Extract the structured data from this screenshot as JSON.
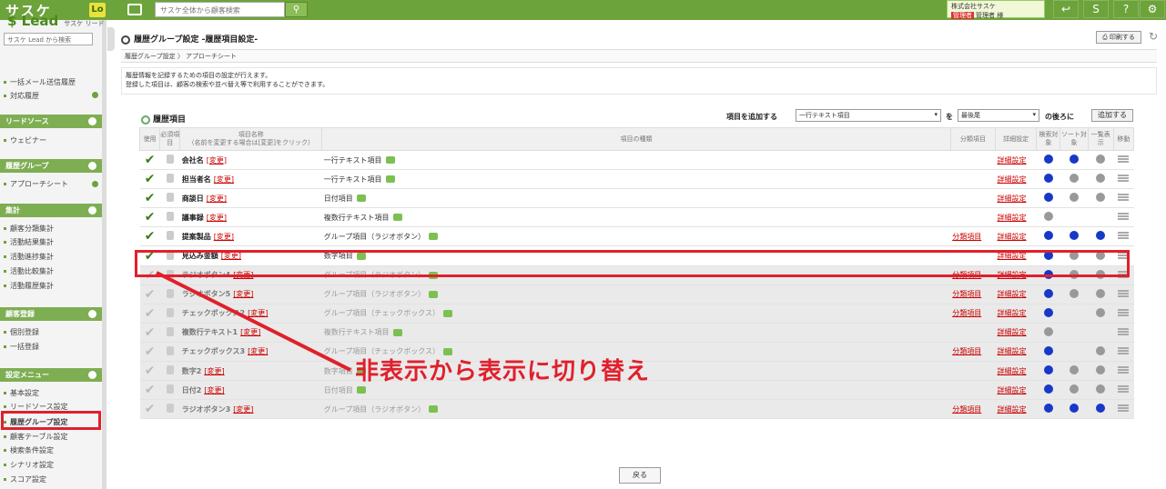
{
  "top": {
    "logo": "サスケ",
    "lo": "Lo",
    "search_placeholder": "サスケ全体から顧客検索",
    "user_company": "株式会社サスケ",
    "user_badge": "管理者",
    "user_name": "管理者 様",
    "help": "?"
  },
  "sidebar": {
    "logo": "Lead",
    "logo_sub": "サスケ リード",
    "search_placeholder": "サスケ Lead から検索",
    "links_top": [
      "一括メール送信履歴",
      "対応履歴"
    ],
    "sec_lead": "リードソース",
    "lead_items": [
      "ウェビナー"
    ],
    "sec_history": "履歴グループ",
    "history_items": [
      "アプローチシート"
    ],
    "sec_agg": "集計",
    "agg_items": [
      "顧客分類集計",
      "活動結果集計",
      "活動進捗集計",
      "活動比較集計",
      "活動履歴集計"
    ],
    "sec_reg": "顧客登録",
    "reg_items": [
      "個別登録",
      "一括登録"
    ],
    "sec_settings": "設定メニュー",
    "settings_items": [
      "基本設定",
      "リードソース設定",
      "履歴グループ設定",
      "顧客テーブル設定",
      "検索条件設定",
      "シナリオ設定",
      "スコア設定"
    ]
  },
  "page": {
    "title": "履歴グループ設定 -履歴項目設定-",
    "print": "印刷する",
    "crumb1": "履歴グループ設定",
    "crumb2": "アプローチシート",
    "desc1": "履歴情報を記録するための項目の設定が行えます。",
    "desc2": "登録した項目は、顧客の検索や並べ替え等で利用することができます。",
    "section": "履歴項目",
    "add_label": "項目を追加する",
    "add_type": "一行テキスト項目",
    "add_wo": "を",
    "add_pos": "最後尾",
    "add_after": "の後ろに",
    "add_button": "追加する",
    "back": "戻る"
  },
  "table": {
    "headers": {
      "use": "使用",
      "req": "必須項目",
      "name": "項目名称",
      "name_sub": "（名前を変更する場合は[変更]をクリック）",
      "type": "項目の種類",
      "cls": "分類項目",
      "detail": "詳細設定",
      "search": "検索対象",
      "sort": "ソート対象",
      "list": "一覧表示",
      "move": "移動"
    },
    "change_label": "[変更]",
    "cls_label": "分類項目",
    "detail_label": "詳細設定",
    "rows": [
      {
        "name": "会社名",
        "type": "一行テキスト項目",
        "cls": "",
        "hidden": false,
        "s": "blue",
        "o": "blue",
        "l": "gray"
      },
      {
        "name": "担当者名",
        "type": "一行テキスト項目",
        "cls": "",
        "hidden": false,
        "s": "blue",
        "o": "gray",
        "l": "gray"
      },
      {
        "name": "商談日",
        "type": "日付項目",
        "cls": "",
        "hidden": false,
        "s": "blue",
        "o": "gray",
        "l": "gray"
      },
      {
        "name": "議事録",
        "type": "複数行テキスト項目",
        "cls": "",
        "hidden": false,
        "s": "gray",
        "o": "none",
        "l": "none"
      },
      {
        "name": "提案製品",
        "type": "グループ項目（ラジオボタン）",
        "cls": "分類項目",
        "hidden": false,
        "s": "blue",
        "o": "blue",
        "l": "blue"
      },
      {
        "name": "見込み金額",
        "type": "数字項目",
        "cls": "",
        "hidden": false,
        "s": "blue",
        "o": "gray",
        "l": "gray"
      },
      {
        "name": "ラジオボタン4",
        "type": "グループ項目（ラジオボタン）",
        "cls": "分類項目",
        "hidden": true,
        "s": "blue",
        "o": "gray",
        "l": "gray"
      },
      {
        "name": "ラジオボタン5",
        "type": "グループ項目（ラジオボタン）",
        "cls": "分類項目",
        "hidden": true,
        "s": "blue",
        "o": "gray",
        "l": "gray"
      },
      {
        "name": "チェックボックス2",
        "type": "グループ項目（チェックボックス）",
        "cls": "分類項目",
        "hidden": true,
        "s": "blue",
        "o": "none",
        "l": "gray"
      },
      {
        "name": "複数行テキスト1",
        "type": "複数行テキスト項目",
        "cls": "",
        "hidden": true,
        "s": "gray",
        "o": "none",
        "l": "none"
      },
      {
        "name": "チェックボックス3",
        "type": "グループ項目（チェックボックス）",
        "cls": "分類項目",
        "hidden": true,
        "s": "blue",
        "o": "none",
        "l": "gray"
      },
      {
        "name": "数字2",
        "type": "数字項目",
        "cls": "",
        "hidden": true,
        "s": "blue",
        "o": "gray",
        "l": "gray"
      },
      {
        "name": "日付2",
        "type": "日付項目",
        "cls": "",
        "hidden": true,
        "s": "blue",
        "o": "gray",
        "l": "gray"
      },
      {
        "name": "ラジオボタン3",
        "type": "グループ項目（ラジオボタン）",
        "cls": "分類項目",
        "hidden": true,
        "s": "blue",
        "o": "blue",
        "l": "blue"
      }
    ]
  },
  "annotation": "非表示から表示に切り替え"
}
